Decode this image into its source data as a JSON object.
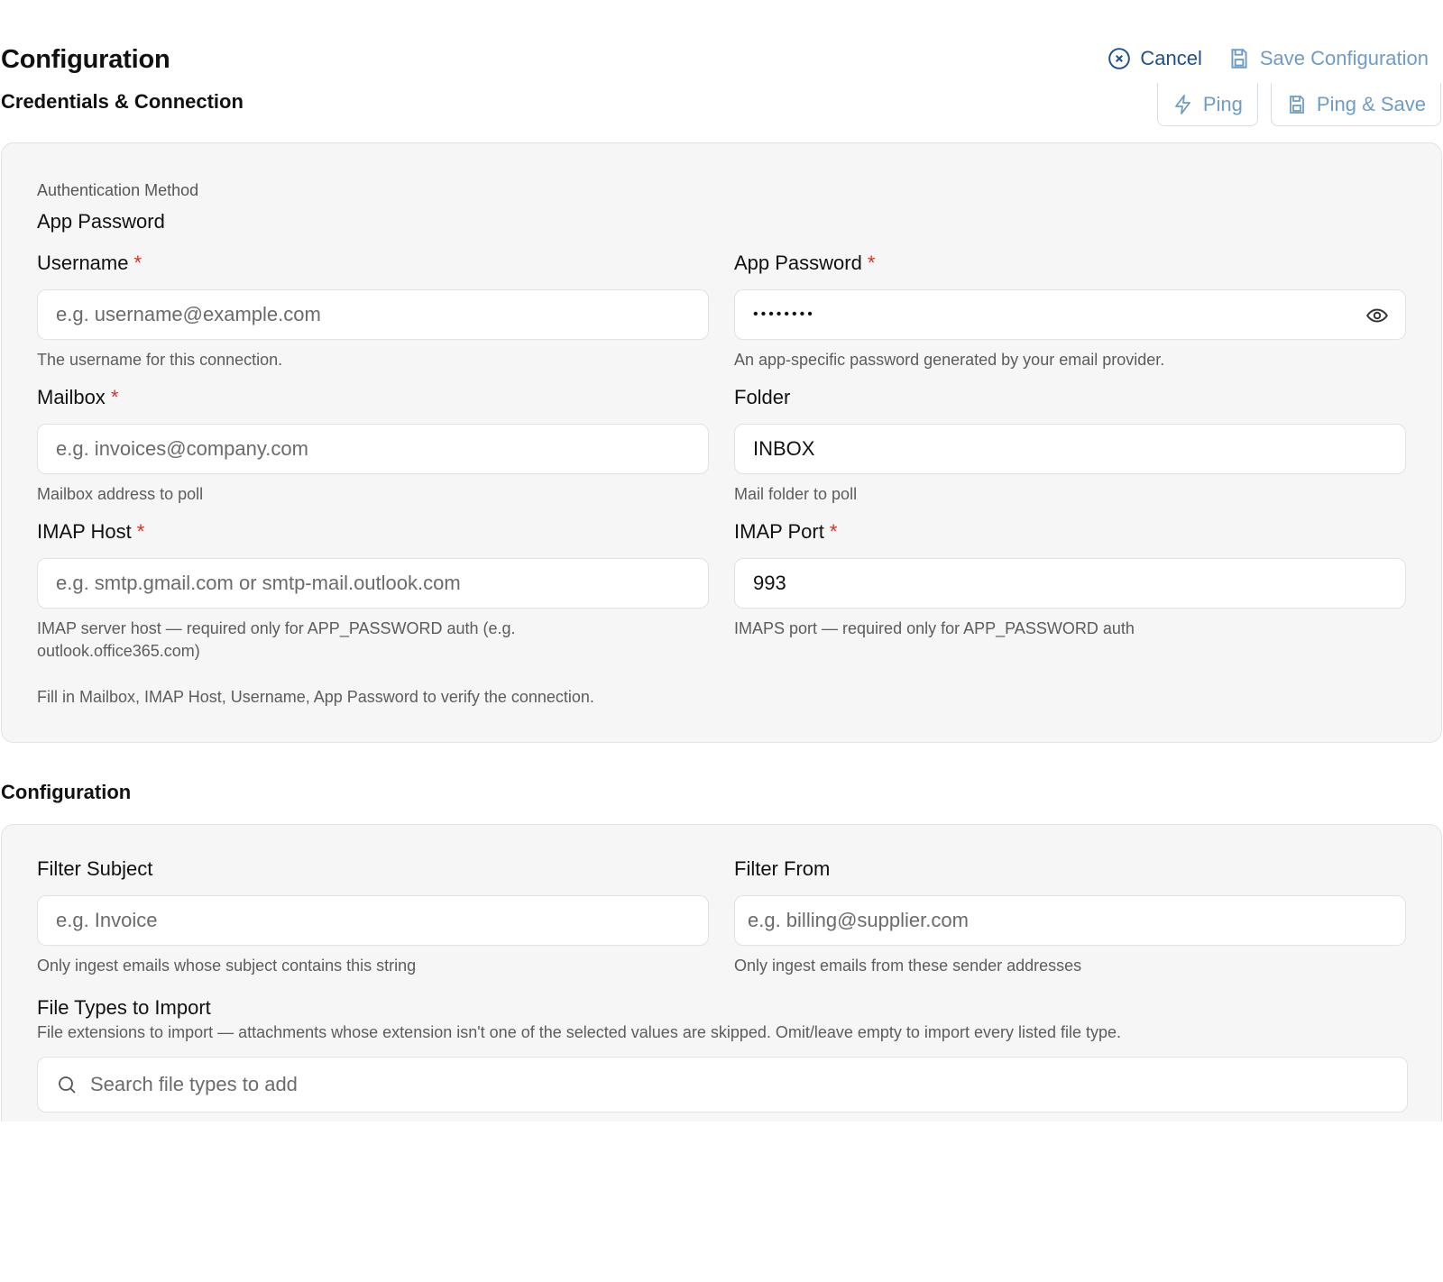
{
  "header": {
    "title": "Configuration",
    "subtitle": "Credentials & Connection",
    "cancel_label": "Cancel",
    "save_label": "Save Configuration",
    "ping_label": "Ping",
    "ping_save_label": "Ping & Save"
  },
  "credentials": {
    "auth_method_label": "Authentication Method",
    "auth_method_value": "App Password",
    "username": {
      "label": "Username",
      "required": "*",
      "placeholder": "e.g. username@example.com",
      "help": "The username for this connection."
    },
    "app_password": {
      "label": "App Password",
      "required": "*",
      "masked_value": "••••••••",
      "help": "An app-specific password generated by your email provider."
    },
    "mailbox": {
      "label": "Mailbox",
      "required": "*",
      "placeholder": "e.g. invoices@company.com",
      "help": "Mailbox address to poll"
    },
    "folder": {
      "label": "Folder",
      "value": "INBOX",
      "help": "Mail folder to poll"
    },
    "imap_host": {
      "label": "IMAP Host",
      "required": "*",
      "placeholder": "e.g. smtp.gmail.com or smtp-mail.outlook.com",
      "help": "IMAP server host — required only for APP_PASSWORD auth (e.g. outlook.office365.com)"
    },
    "imap_port": {
      "label": "IMAP Port",
      "required": "*",
      "value": "993",
      "help": "IMAPS port — required only for APP_PASSWORD auth"
    },
    "verify_note": "Fill in Mailbox, IMAP Host, Username, App Password to verify the connection."
  },
  "configuration": {
    "title": "Configuration",
    "filter_subject": {
      "label": "Filter Subject",
      "placeholder": "e.g. Invoice",
      "help": "Only ingest emails whose subject contains this string"
    },
    "filter_from": {
      "label": "Filter From",
      "placeholder": "e.g. billing@supplier.com",
      "help": "Only ingest emails from these sender addresses"
    },
    "file_types": {
      "label": "File Types to Import",
      "description": "File extensions to import — attachments whose extension isn't one of the selected values are skipped. Omit/leave empty to import every listed file type.",
      "search_placeholder": "Search file types to add"
    }
  },
  "colors": {
    "primary_link": "#1f4f8c",
    "muted_link": "#6f9cc7",
    "required": "#d93025",
    "card_bg": "#f6f6f6"
  }
}
